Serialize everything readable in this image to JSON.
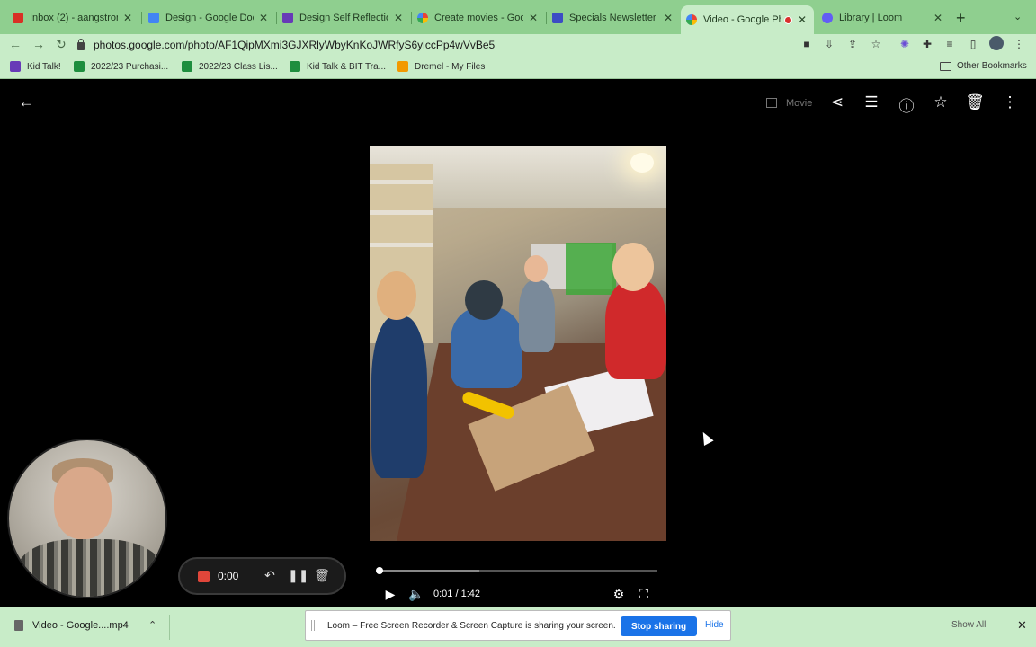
{
  "colors": {
    "tab_strip_bg": "#8fcf8f",
    "toolbar_bg": "#c8ecc8",
    "viewer_bg": "#000000",
    "loom_stop_button": "#1a73e8",
    "record_red": "#e0463a"
  },
  "tabs": [
    {
      "label": "Inbox (2) - aangstrom",
      "icon": "gmail-icon",
      "color": "#d93025"
    },
    {
      "label": "Design - Google Docs",
      "icon": "docs-icon",
      "color": "#4285f4"
    },
    {
      "label": "Design Self Reflection",
      "icon": "forms-icon",
      "color": "#673ab7"
    },
    {
      "label": "Create movies - Goog",
      "icon": "photos-icon",
      "color": "#fbbc04"
    },
    {
      "label": "Specials Newsletter",
      "icon": "calendar-icon",
      "color": "#3c4cc4"
    },
    {
      "label": "Video - Google Ph",
      "icon": "photos-icon",
      "color": "#ea4335"
    },
    {
      "label": "Library | Loom",
      "icon": "loom-icon",
      "color": "#625df5"
    }
  ],
  "address_bar": {
    "url": "photos.google.com/photo/AF1QipMXmi3GJXRlyWbyKnKoJWRfyS6ylccPp4wVvBe5"
  },
  "bookmarks": [
    {
      "label": "Kid Talk!",
      "color": "#673ab7"
    },
    {
      "label": "2022/23 Purchasi...",
      "color": "#1e8e3e"
    },
    {
      "label": "2022/23 Class Lis...",
      "color": "#1e8e3e"
    },
    {
      "label": "Kid Talk & BIT Tra...",
      "color": "#1e8e3e"
    },
    {
      "label": "Dremel - My Files",
      "color": "#f29900"
    }
  ],
  "bookmarks_other": "Other Bookmarks",
  "viewer": {
    "movie_label": "Movie",
    "video_time": "0:01 / 1:42",
    "progress_fraction": 0.003,
    "buffered_fraction": 0.36
  },
  "recorder": {
    "time": "0:00"
  },
  "download": {
    "filename": "Video - Google....mp4",
    "show_all": "Show All"
  },
  "share_banner": {
    "message": "Loom – Free Screen Recorder & Screen Capture is sharing your screen.",
    "stop_label": "Stop sharing",
    "hide_label": "Hide"
  }
}
